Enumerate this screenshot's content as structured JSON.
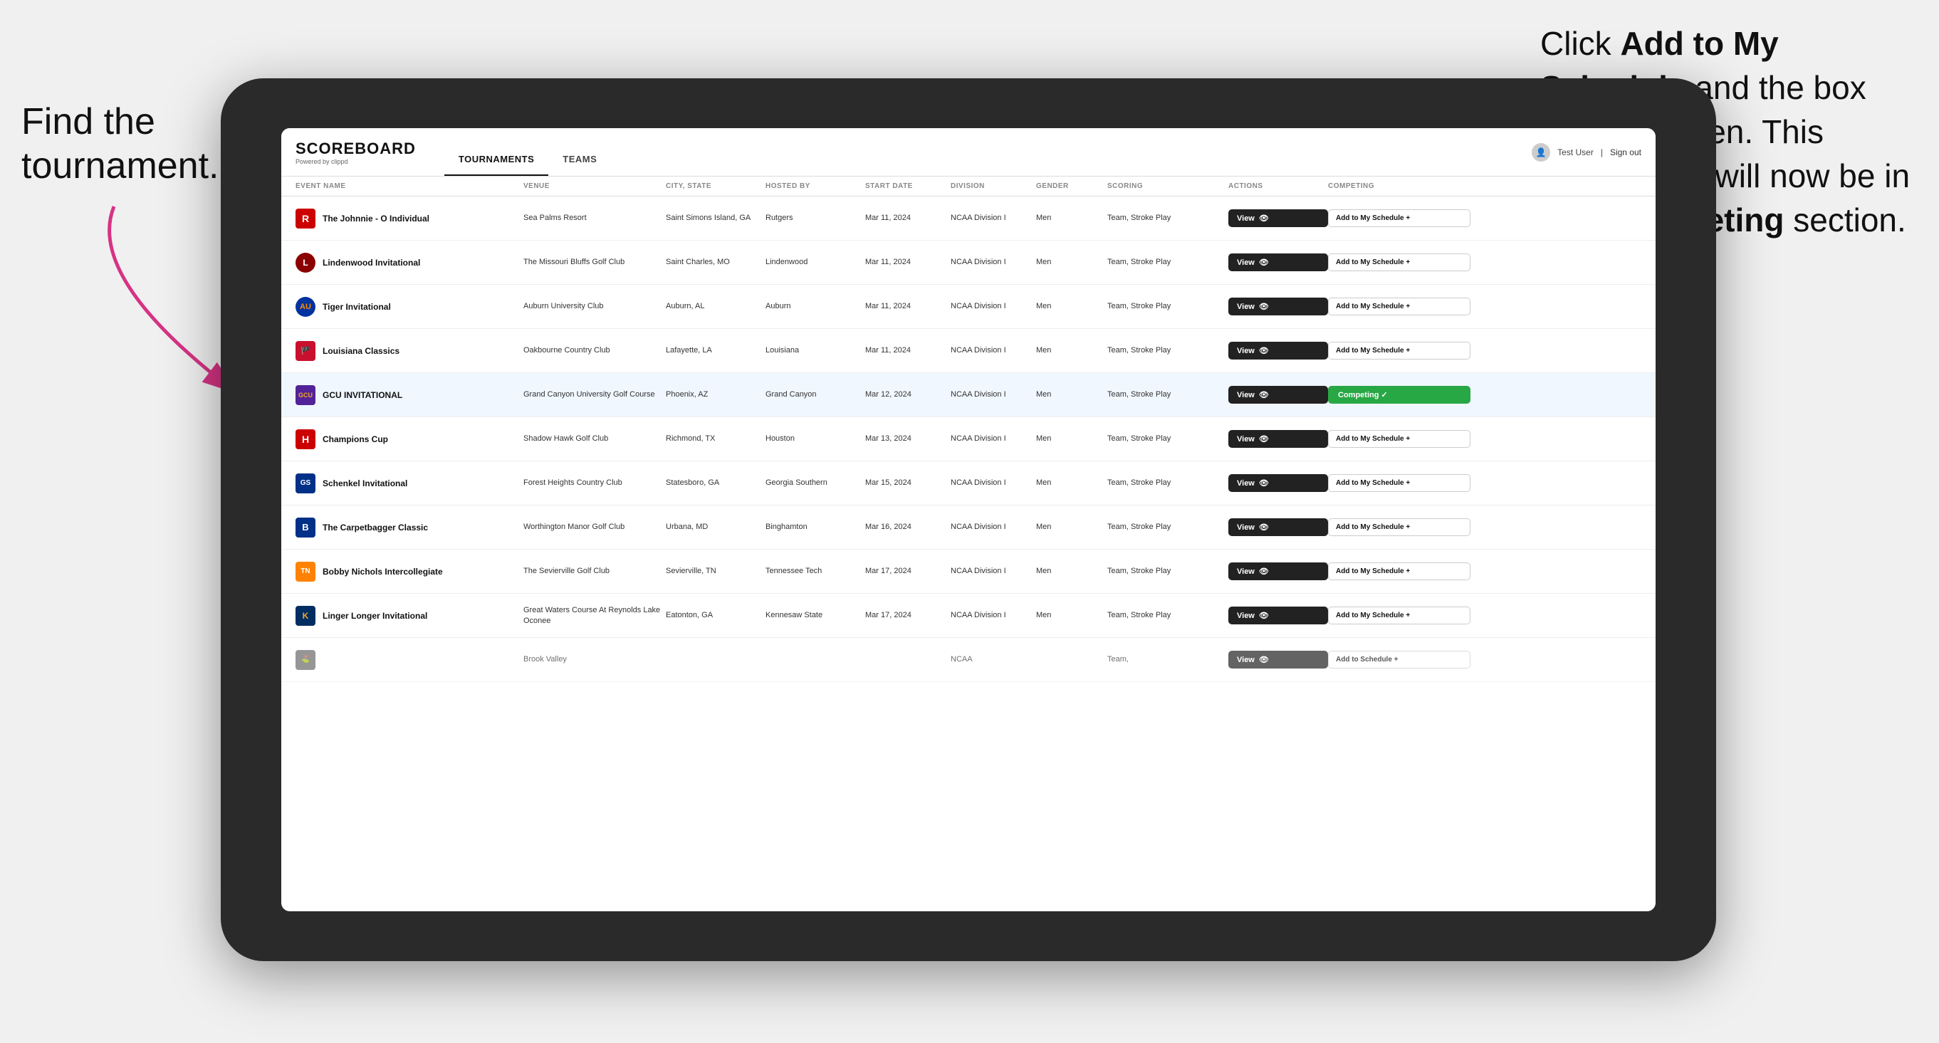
{
  "annotations": {
    "left_text_line1": "Find the",
    "left_text_line2": "tournament.",
    "right_text": "Click ",
    "right_bold1": "Add to My Schedule",
    "right_mid": " and the box will turn green. This tournament will now be in your ",
    "right_bold2": "Competing",
    "right_end": " section."
  },
  "header": {
    "logo_main": "SCOREBOARD",
    "logo_sub": "Powered by clippd",
    "nav_tabs": [
      "TOURNAMENTS",
      "TEAMS"
    ],
    "active_tab": "TOURNAMENTS",
    "user": "Test User",
    "signout": "Sign out"
  },
  "table": {
    "columns": [
      "EVENT NAME",
      "VENUE",
      "CITY, STATE",
      "HOSTED BY",
      "START DATE",
      "DIVISION",
      "GENDER",
      "SCORING",
      "ACTIONS",
      "COMPETING"
    ],
    "rows": [
      {
        "id": 1,
        "logo": "R",
        "logo_class": "logo-r",
        "event": "The Johnnie - O Individual",
        "venue": "Sea Palms Resort",
        "city": "Saint Simons Island, GA",
        "hosted": "Rutgers",
        "date": "Mar 11, 2024",
        "division": "NCAA Division I",
        "gender": "Men",
        "scoring": "Team, Stroke Play",
        "action": "View",
        "competing": "Add to My Schedule +",
        "is_competing": false
      },
      {
        "id": 2,
        "logo": "L",
        "logo_class": "logo-l",
        "event": "Lindenwood Invitational",
        "venue": "The Missouri Bluffs Golf Club",
        "city": "Saint Charles, MO",
        "hosted": "Lindenwood",
        "date": "Mar 11, 2024",
        "division": "NCAA Division I",
        "gender": "Men",
        "scoring": "Team, Stroke Play",
        "action": "View",
        "competing": "Add to My Schedule +",
        "is_competing": false
      },
      {
        "id": 3,
        "logo": "AU",
        "logo_class": "logo-au",
        "event": "Tiger Invitational",
        "venue": "Auburn University Club",
        "city": "Auburn, AL",
        "hosted": "Auburn",
        "date": "Mar 11, 2024",
        "division": "NCAA Division I",
        "gender": "Men",
        "scoring": "Team, Stroke Play",
        "action": "View",
        "competing": "Add to My Schedule +",
        "is_competing": false
      },
      {
        "id": 4,
        "logo": "LA",
        "logo_class": "logo-la",
        "event": "Louisiana Classics",
        "venue": "Oakbourne Country Club",
        "city": "Lafayette, LA",
        "hosted": "Louisiana",
        "date": "Mar 11, 2024",
        "division": "NCAA Division I",
        "gender": "Men",
        "scoring": "Team, Stroke Play",
        "action": "View",
        "competing": "Add to My Schedule +",
        "is_competing": false
      },
      {
        "id": 5,
        "logo": "GCU",
        "logo_class": "logo-gcu",
        "event": "GCU INVITATIONAL",
        "venue": "Grand Canyon University Golf Course",
        "city": "Phoenix, AZ",
        "hosted": "Grand Canyon",
        "date": "Mar 12, 2024",
        "division": "NCAA Division I",
        "gender": "Men",
        "scoring": "Team, Stroke Play",
        "action": "View",
        "competing": "Competing",
        "is_competing": true
      },
      {
        "id": 6,
        "logo": "H",
        "logo_class": "logo-h",
        "event": "Champions Cup",
        "venue": "Shadow Hawk Golf Club",
        "city": "Richmond, TX",
        "hosted": "Houston",
        "date": "Mar 13, 2024",
        "division": "NCAA Division I",
        "gender": "Men",
        "scoring": "Team, Stroke Play",
        "action": "View",
        "competing": "Add to My Schedule +",
        "is_competing": false
      },
      {
        "id": 7,
        "logo": "GS",
        "logo_class": "logo-gs",
        "event": "Schenkel Invitational",
        "venue": "Forest Heights Country Club",
        "city": "Statesboro, GA",
        "hosted": "Georgia Southern",
        "date": "Mar 15, 2024",
        "division": "NCAA Division I",
        "gender": "Men",
        "scoring": "Team, Stroke Play",
        "action": "View",
        "competing": "Add to My Schedule +",
        "is_competing": false
      },
      {
        "id": 8,
        "logo": "B",
        "logo_class": "logo-b",
        "event": "The Carpetbagger Classic",
        "venue": "Worthington Manor Golf Club",
        "city": "Urbana, MD",
        "hosted": "Binghamton",
        "date": "Mar 16, 2024",
        "division": "NCAA Division I",
        "gender": "Men",
        "scoring": "Team, Stroke Play",
        "action": "View",
        "competing": "Add to My Schedule +",
        "is_competing": false
      },
      {
        "id": 9,
        "logo": "TN",
        "logo_class": "logo-tn",
        "event": "Bobby Nichols Intercollegiate",
        "venue": "The Sevierville Golf Club",
        "city": "Sevierville, TN",
        "hosted": "Tennessee Tech",
        "date": "Mar 17, 2024",
        "division": "NCAA Division I",
        "gender": "Men",
        "scoring": "Team, Stroke Play",
        "action": "View",
        "competing": "Add to My Schedule +",
        "is_competing": false
      },
      {
        "id": 10,
        "logo": "K",
        "logo_class": "logo-k",
        "event": "Linger Longer Invitational",
        "venue": "Great Waters Course At Reynolds Lake Oconee",
        "city": "Eatonton, GA",
        "hosted": "Kennesaw State",
        "date": "Mar 17, 2024",
        "division": "NCAA Division I",
        "gender": "Men",
        "scoring": "Team, Stroke Play",
        "action": "View",
        "competing": "Add to My Schedule +",
        "is_competing": false
      },
      {
        "id": 11,
        "logo": "...",
        "logo_class": "logo-last",
        "event": "",
        "venue": "Brook Valley",
        "city": "",
        "hosted": "",
        "date": "",
        "division": "NCAA",
        "gender": "",
        "scoring": "Team,",
        "action": "View",
        "competing": "Add to Schedule +",
        "is_competing": false
      }
    ]
  },
  "buttons": {
    "view_label": "View",
    "add_label": "Add to My Schedule +",
    "competing_label": "Competing ✓",
    "add_schedule": "Add to Schedule +"
  }
}
